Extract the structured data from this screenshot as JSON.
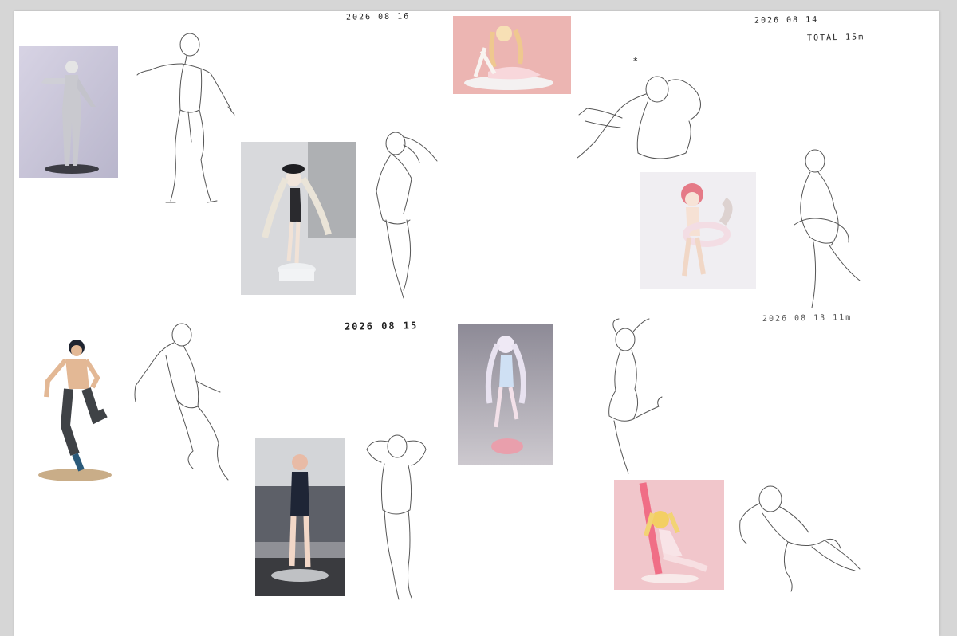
{
  "dates": {
    "d1": "2026 08 16",
    "d2": "2026 08 14",
    "d3": "TOTAL 15m",
    "d4": "2026 08 15",
    "d5": "2026 08 13 11m"
  },
  "marks": {
    "star": "*"
  },
  "colors": {
    "canvas": "#ffffff",
    "desk": "#d6d6d6",
    "pencil": "#555555",
    "photo_pink": "#f2c9c6",
    "photo_grey": "#d9dadf"
  }
}
